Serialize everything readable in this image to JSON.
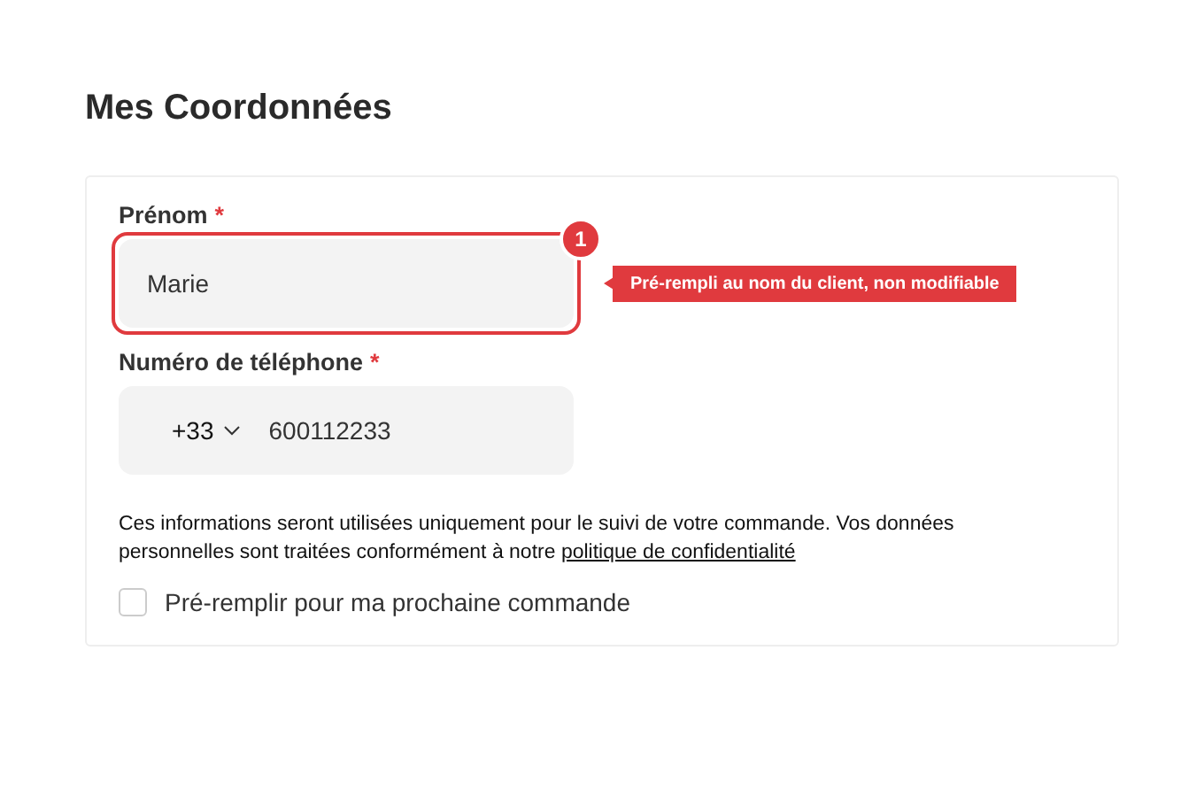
{
  "title": "Mes Coordonnées",
  "fields": [
    {
      "kind": "text",
      "label": "Prénom",
      "required": true,
      "value": "Marie",
      "highlighted": true,
      "badge": "1",
      "note": "Pré-rempli au nom du client, non modifiable"
    },
    {
      "kind": "phone",
      "label": "Numéro de téléphone",
      "required": true,
      "country_code": "+33",
      "value": "600112233",
      "highlighted": false
    }
  ],
  "required_mark": "*",
  "notice": {
    "text": "Ces informations seront utilisées uniquement pour le suivi de votre commande. Vos données personnelles sont traitées conformément à notre ",
    "link": "politique de confidentialité"
  },
  "prefill": {
    "label": "Pré-remplir pour ma prochaine commande",
    "checked": false
  }
}
